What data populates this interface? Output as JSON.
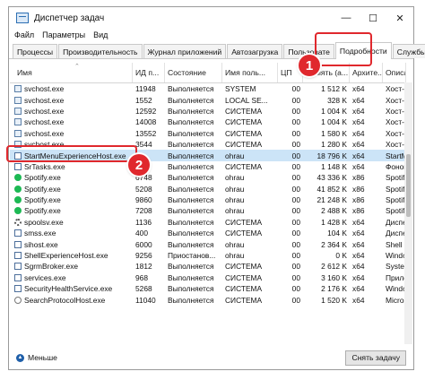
{
  "window": {
    "title": "Диспетчер задач",
    "controls": {
      "minimize": "—",
      "maximize": "☐",
      "close": "✕"
    },
    "menu": [
      "Файл",
      "Параметры",
      "Вид"
    ],
    "tabs": [
      "Процессы",
      "Производительность",
      "Журнал приложений",
      "Автозагрузка",
      "Пользовате",
      "Подробности",
      "Службы"
    ],
    "active_tab": "Подробности"
  },
  "table": {
    "columns": [
      "Имя",
      "ИД п...",
      "Состояние",
      "Имя поль...",
      "ЦП",
      "Память (а...",
      "Архите...",
      "Описа"
    ],
    "rows": [
      {
        "icon": "service-icon",
        "name": "svchost.exe",
        "pid": "11948",
        "status": "Выполняется",
        "user": "SYSTEM",
        "cpu": "00",
        "mem": "1 512 K",
        "arch": "x64",
        "desc": "Хост-п"
      },
      {
        "icon": "service-icon",
        "name": "svchost.exe",
        "pid": "1552",
        "status": "Выполняется",
        "user": "LOCAL SE...",
        "cpu": "00",
        "mem": "328 K",
        "arch": "x64",
        "desc": "Хост-п"
      },
      {
        "icon": "service-icon",
        "name": "svchost.exe",
        "pid": "12592",
        "status": "Выполняется",
        "user": "СИСТЕМА",
        "cpu": "00",
        "mem": "1 004 K",
        "arch": "x64",
        "desc": "Хост-п"
      },
      {
        "icon": "service-icon",
        "name": "svchost.exe",
        "pid": "14008",
        "status": "Выполняется",
        "user": "СИСТЕМА",
        "cpu": "00",
        "mem": "1 004 K",
        "arch": "x64",
        "desc": "Хост-п"
      },
      {
        "icon": "service-icon",
        "name": "svchost.exe",
        "pid": "13552",
        "status": "Выполняется",
        "user": "СИСТЕМА",
        "cpu": "00",
        "mem": "1 580 K",
        "arch": "x64",
        "desc": "Хост-п"
      },
      {
        "icon": "service-icon",
        "name": "svchost.exe",
        "pid": "3544",
        "status": "Выполняется",
        "user": "СИСТЕМА",
        "cpu": "00",
        "mem": "1 280 K",
        "arch": "x64",
        "desc": "Хост-п"
      },
      {
        "icon": "exe-icon",
        "name": "StartMenuExperienceHost.exe",
        "pid": "",
        "status": "Выполняется",
        "user": "ohrau",
        "cpu": "00",
        "mem": "18 796 K",
        "arch": "x64",
        "desc": "StartM",
        "selected": true
      },
      {
        "icon": "exe-icon",
        "name": "SrTasks.exe",
        "pid": "",
        "status": "Выполняется",
        "user": "СИСТЕМА",
        "cpu": "00",
        "mem": "1 148 K",
        "arch": "x64",
        "desc": "Фонов"
      },
      {
        "icon": "spotify-icon",
        "name": "Spotify.exe",
        "pid": "6748",
        "status": "Выполняется",
        "user": "ohrau",
        "cpu": "00",
        "mem": "43 336 K",
        "arch": "x86",
        "desc": "Spotif"
      },
      {
        "icon": "spotify-icon",
        "name": "Spotify.exe",
        "pid": "5208",
        "status": "Выполняется",
        "user": "ohrau",
        "cpu": "00",
        "mem": "41 852 K",
        "arch": "x86",
        "desc": "Spotif"
      },
      {
        "icon": "spotify-icon",
        "name": "Spotify.exe",
        "pid": "9860",
        "status": "Выполняется",
        "user": "ohrau",
        "cpu": "00",
        "mem": "21 248 K",
        "arch": "x86",
        "desc": "Spotif"
      },
      {
        "icon": "spotify-icon",
        "name": "Spotify.exe",
        "pid": "7208",
        "status": "Выполняется",
        "user": "ohrau",
        "cpu": "00",
        "mem": "2 488 K",
        "arch": "x86",
        "desc": "Spotif"
      },
      {
        "icon": "gear-icon",
        "name": "spoolsv.exe",
        "pid": "1136",
        "status": "Выполняется",
        "user": "СИСТЕМА",
        "cpu": "00",
        "mem": "1 428 K",
        "arch": "x64",
        "desc": "Диспе"
      },
      {
        "icon": "exe-icon",
        "name": "smss.exe",
        "pid": "400",
        "status": "Выполняется",
        "user": "СИСТЕМА",
        "cpu": "00",
        "mem": "104 K",
        "arch": "x64",
        "desc": "Диспе"
      },
      {
        "icon": "exe-icon",
        "name": "sihost.exe",
        "pid": "6000",
        "status": "Выполняется",
        "user": "ohrau",
        "cpu": "00",
        "mem": "2 364 K",
        "arch": "x64",
        "desc": "Shell I"
      },
      {
        "icon": "exe-icon",
        "name": "ShellExperienceHost.exe",
        "pid": "9256",
        "status": "Приостанов...",
        "user": "ohrau",
        "cpu": "00",
        "mem": "0 K",
        "arch": "x64",
        "desc": "Windo"
      },
      {
        "icon": "exe-icon",
        "name": "SgrmBroker.exe",
        "pid": "1812",
        "status": "Выполняется",
        "user": "СИСТЕМА",
        "cpu": "00",
        "mem": "2 612 K",
        "arch": "x64",
        "desc": "Syster"
      },
      {
        "icon": "exe-icon",
        "name": "services.exe",
        "pid": "968",
        "status": "Выполняется",
        "user": "СИСТЕМА",
        "cpu": "00",
        "mem": "3 160 K",
        "arch": "x64",
        "desc": "Прилс"
      },
      {
        "icon": "exe-icon",
        "name": "SecurityHealthService.exe",
        "pid": "5268",
        "status": "Выполняется",
        "user": "СИСТЕМА",
        "cpu": "00",
        "mem": "2 176 K",
        "arch": "x64",
        "desc": "Windo"
      },
      {
        "icon": "search-icon",
        "name": "SearchProtocolHost.exe",
        "pid": "11040",
        "status": "Выполняется",
        "user": "СИСТЕМА",
        "cpu": "00",
        "mem": "1 520 K",
        "arch": "x64",
        "desc": "Micros"
      }
    ]
  },
  "footer": {
    "fewer_label": "Меньше",
    "end_task_label": "Снять задачу"
  },
  "callouts": [
    "1",
    "2"
  ],
  "colors": {
    "callout": "#e0282d",
    "selection": "#cce4f7",
    "spotify": "#1db954"
  }
}
